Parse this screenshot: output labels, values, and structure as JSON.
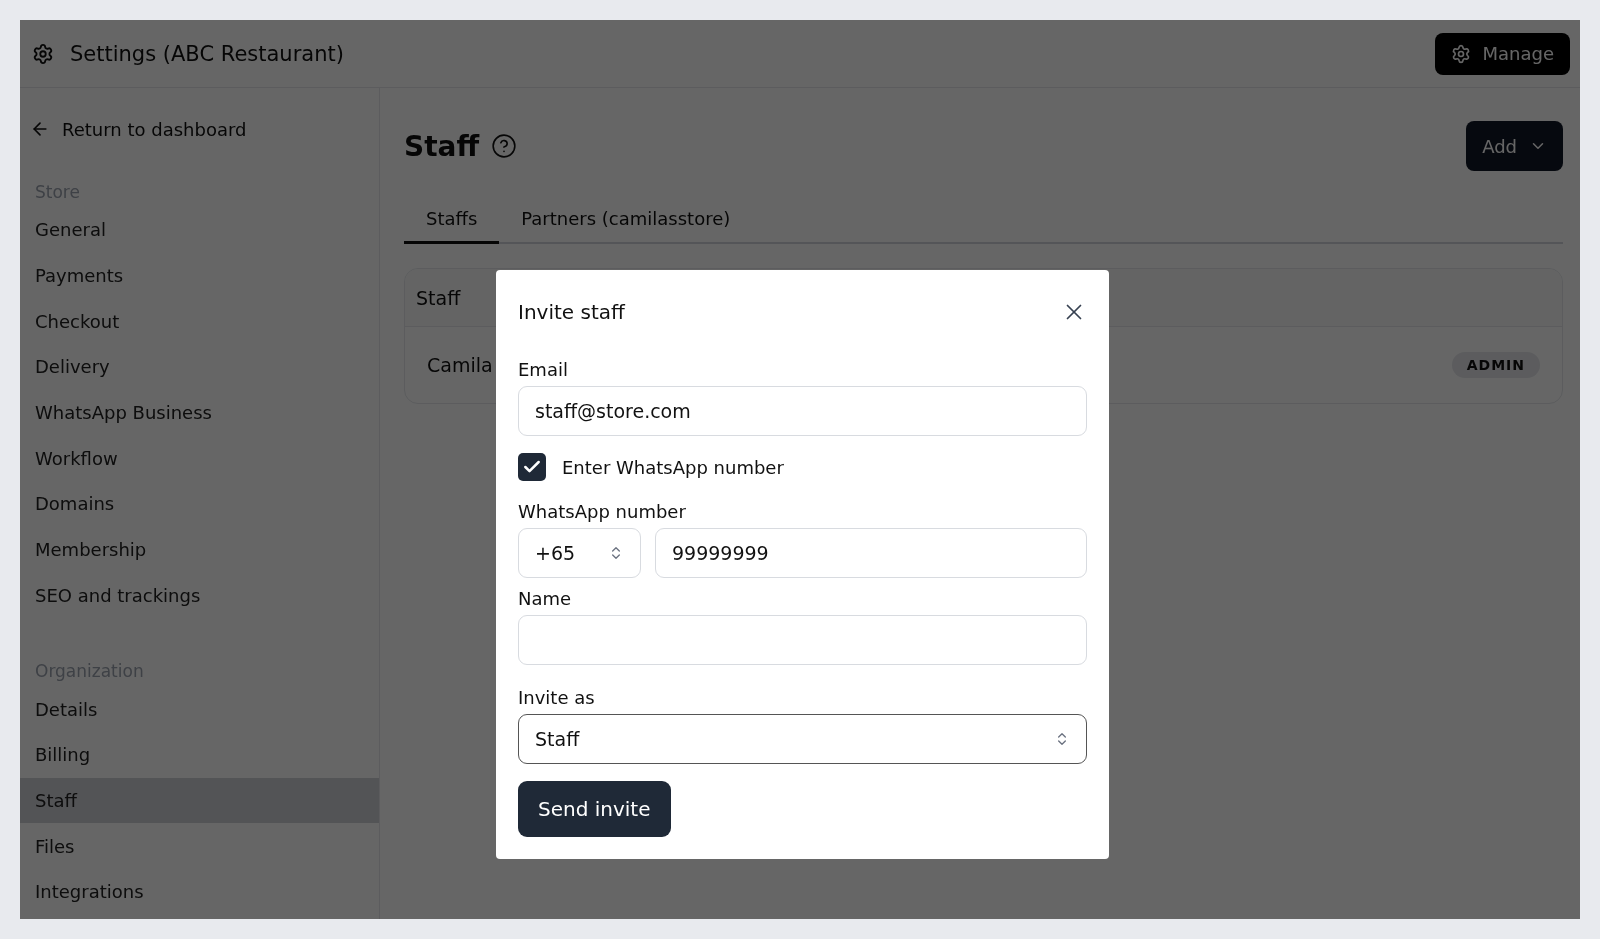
{
  "header": {
    "title": "Settings (ABC Restaurant)",
    "manage_button": "Manage"
  },
  "sidebar": {
    "return_link": "Return to dashboard",
    "sections": [
      {
        "heading": "Store",
        "items": [
          {
            "label": "General",
            "selected": false
          },
          {
            "label": "Payments",
            "selected": false
          },
          {
            "label": "Checkout",
            "selected": false
          },
          {
            "label": "Delivery",
            "selected": false
          },
          {
            "label": "WhatsApp Business",
            "selected": false
          },
          {
            "label": "Workflow",
            "selected": false
          },
          {
            "label": "Domains",
            "selected": false
          },
          {
            "label": "Membership",
            "selected": false
          },
          {
            "label": "SEO and trackings",
            "selected": false
          }
        ]
      },
      {
        "heading": "Organization",
        "items": [
          {
            "label": "Details",
            "selected": false
          },
          {
            "label": "Billing",
            "selected": false
          },
          {
            "label": "Staff",
            "selected": true
          },
          {
            "label": "Files",
            "selected": false
          },
          {
            "label": "Integrations",
            "selected": false
          }
        ]
      }
    ]
  },
  "main": {
    "title": "Staff",
    "add_button": "Add",
    "tabs": [
      {
        "label": "Staffs",
        "selected": true
      },
      {
        "label": "Partners (camilasstore)",
        "selected": false
      }
    ],
    "table": {
      "columns": [
        "Staff"
      ],
      "rows": [
        {
          "name": "Camila",
          "role": "ADMIN"
        }
      ]
    }
  },
  "dialog": {
    "title": "Invite staff",
    "email": {
      "label": "Email",
      "value": "staff@store.com"
    },
    "whatsapp_toggle": {
      "label": "Enter WhatsApp number",
      "checked": true
    },
    "whatsapp": {
      "label": "WhatsApp number",
      "country_code": "+65",
      "number": "99999999"
    },
    "name": {
      "label": "Name"
    },
    "invite_as": {
      "label": "Invite as",
      "value": "Staff"
    },
    "submit": "Send invite"
  }
}
